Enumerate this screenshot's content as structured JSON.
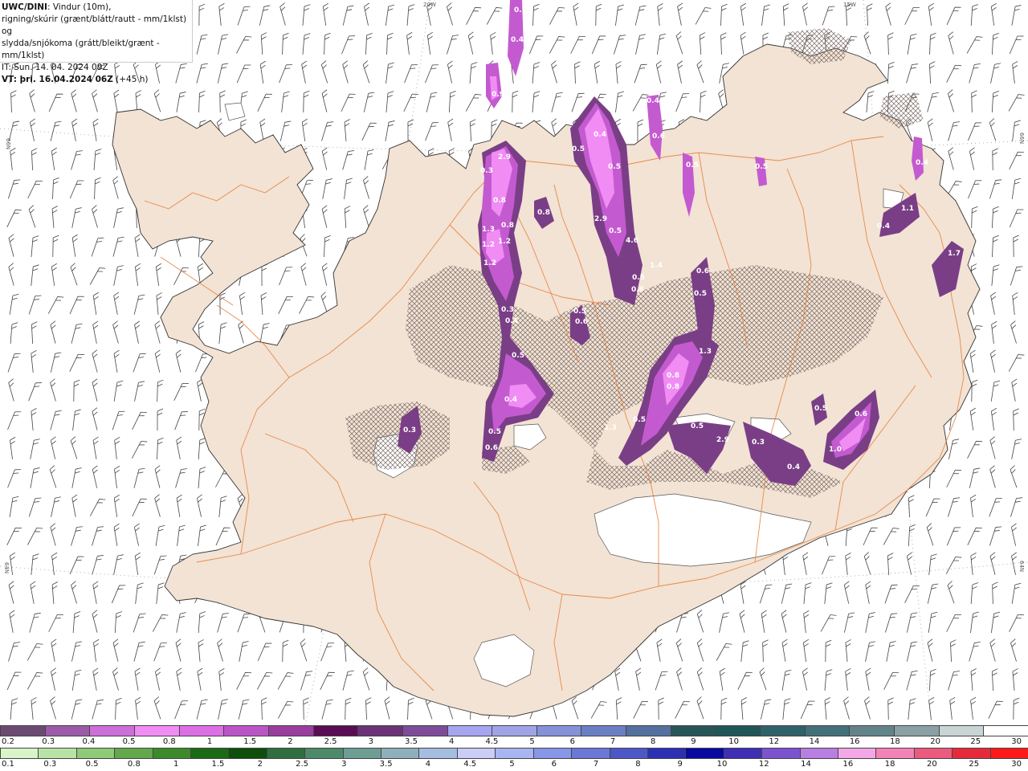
{
  "info": {
    "model": "UWC/DINI",
    "line1_rest": ": Vindur (10m),",
    "line2": "rigning/skúrir (grænt/blátt/rautt - mm/1klst) og",
    "line3": "slydda/snjókoma (grátt/bleikt/grænt - mm/1klst)",
    "it": "IT: Sun. 14. 04. 2024 09Z",
    "vt": "VT: þri. 16.04.2024 06Z",
    "vt_rest": " (+45 h)"
  },
  "map": {
    "land_color": "#f2e3d4",
    "road_color": "#e8803c",
    "snow_hatch_color": "#7a6a66",
    "precip_light": "#f08cf4",
    "precip_mid": "#c45ad0",
    "precip_dark": "#7a3e86",
    "coord_labels": {
      "lon_20w": "20W",
      "lon_15w": "15W",
      "lat_66n_left": "66N",
      "lat_66n_right": "66N",
      "lat_64n_left": "64N",
      "lat_64n_right": "64N"
    },
    "precip_labels": [
      "0.9",
      "2.9",
      "0.3",
      "0.8",
      "0.8",
      "1.3",
      "0.8",
      "1.2",
      "1.2",
      "1.2",
      "0.3",
      "0.4",
      "0.5",
      "0.6",
      "0.5",
      "0.4",
      "0.5",
      "0.6",
      "0.3",
      "0.7",
      "0.4",
      "0.5",
      "0.4",
      "0.5",
      "2.9",
      "0.5",
      "4.6",
      "1.4",
      "0.5",
      "0.6",
      "0.4",
      "0.5",
      "0.5",
      "0.6",
      "0.6",
      "0.5",
      "0.4",
      "0.8",
      "0.8",
      "1.3",
      "0.5",
      "1.3",
      "0.5",
      "2.9",
      "0.3",
      "0.4",
      "0.5",
      "0.6",
      "1.0",
      "0.4",
      "1.1",
      "1.7"
    ]
  },
  "snow_scale": {
    "colors": [
      "#6c4b72",
      "#9b5ba6",
      "#cd6fd8",
      "#f08cf4",
      "#dd6fe6",
      "#bb55c7",
      "#9a3d9f",
      "#5a0d55",
      "#6b3277",
      "#7f4c9a",
      "#a7a5ef",
      "#9fa4e6",
      "#8592d8",
      "#6a7fc4",
      "#53709f",
      "#285658",
      "#215658",
      "#2f626b",
      "#43707a",
      "#63838b",
      "#8aa0a4",
      "#c9d4d4",
      "#ffffff"
    ],
    "labels": [
      "0.2",
      "0.3",
      "0.4",
      "0.5",
      "0.8",
      "1",
      "1.5",
      "2",
      "2.5",
      "3",
      "3.5",
      "4",
      "4.5",
      "5",
      "6",
      "7",
      "8",
      "9",
      "10",
      "12",
      "14",
      "16",
      "18",
      "20",
      "25",
      "30"
    ]
  },
  "rain_scale": {
    "colors": [
      "#d8f4c8",
      "#b9e3a6",
      "#8fca79",
      "#63a84c",
      "#3c8a2c",
      "#1b6b15",
      "#0e4f0b",
      "#2f6f3f",
      "#4c8a6a",
      "#6e9e93",
      "#8fb0bb",
      "#a6bde2",
      "#c9cdf8",
      "#a9b5f1",
      "#8896e8",
      "#6b78d8",
      "#4c58c8",
      "#2c30b5",
      "#0a0aa0",
      "#3e2fb6",
      "#7c53ce",
      "#b87ee2",
      "#f4a7e6",
      "#f382b5",
      "#ec5a7e",
      "#e62a3c",
      "#ff1a1a"
    ],
    "labels": [
      "0.1",
      "0.3",
      "0.5",
      "0.8",
      "1",
      "1.5",
      "2",
      "2.5",
      "3",
      "3.5",
      "4",
      "4.5",
      "5",
      "6",
      "7",
      "8",
      "9",
      "10",
      "12",
      "14",
      "16",
      "18",
      "20",
      "25",
      "30"
    ]
  }
}
